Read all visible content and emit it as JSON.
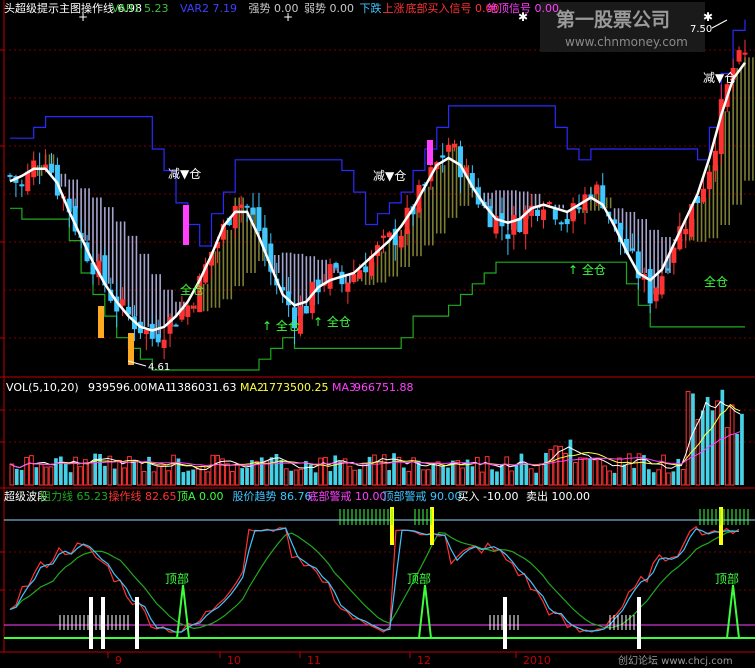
{
  "colors": {
    "bg": "#000000",
    "up": "#ff3232",
    "down": "#3ec6ff",
    "limit": "#ff40ff",
    "ma_white": "#ffffff",
    "resistance": "#2a2aff",
    "support": "#1faa1f",
    "hist_up": "#8b8b3c",
    "hist_dn": "#b6b6e6",
    "yellow": "#ffff00",
    "axis": "#c00000",
    "green_text": "#3cff3c",
    "watermark": "#9a9a9a"
  },
  "main": {
    "indicator_bar": [
      {
        "name": "头超级提示主图操作线",
        "value": "6.98",
        "color": "#ffffff"
      },
      {
        "name": "VAR1",
        "value": "5.23",
        "color": "#3cc03c"
      },
      {
        "name": "VAR2",
        "value": "7.19",
        "color": "#4040ff"
      },
      {
        "name": "强势",
        "value": "0.00",
        "color": "#c8c8c8"
      },
      {
        "name": "弱势",
        "value": "0.00",
        "color": "#c8c8c8"
      },
      {
        "name": "下跌",
        "value": "",
        "color": "#3ec6ff"
      },
      {
        "name": "上涨",
        "value": "",
        "color": "#ff3232"
      },
      {
        "name": "底部买入信号",
        "value": "0.00",
        "color": "#ff3232"
      },
      {
        "name": "绝顶信号",
        "value": "0.00",
        "color": "#ff40ff"
      }
    ],
    "high_label": "7.50",
    "low_label": "4.61",
    "labels": {
      "reduce": "减▼仓",
      "full": "全仓",
      "full_up": "↑ 全仓"
    },
    "watermark_title": "第一股票公司",
    "watermark_url": "www.chnmoney.com"
  },
  "volume": {
    "title": "VOL(5,10,20)",
    "value": "939596.00",
    "ma1_label": "MA1",
    "ma1_value": "1386031.63",
    "ma2_label": "MA2",
    "ma2_value": "1773500.25",
    "ma3_label": "MA3",
    "ma3_value": "966751.88"
  },
  "osc": {
    "items": [
      {
        "name": "超级波段",
        "value": "",
        "color": "#ffffff"
      },
      {
        "name": "阻力线",
        "value": "65.23",
        "color": "#1faa1f"
      },
      {
        "name": "操作线",
        "value": "82.65",
        "color": "#ff3232"
      },
      {
        "name": "顶A",
        "value": "0.00",
        "color": "#3cff3c"
      },
      {
        "name": "股价趋势",
        "value": "86.76",
        "color": "#3ec6ff"
      },
      {
        "name": "底部警戒",
        "value": "10.00",
        "color": "#ff40ff"
      },
      {
        "name": "顶部警戒",
        "value": "90.00",
        "color": "#3ec6ff"
      },
      {
        "name": "买入",
        "value": "-10.00",
        "color": "#ffffff"
      },
      {
        "name": "卖出",
        "value": "100.00",
        "color": "#ffffff"
      }
    ],
    "top_label": "顶部"
  },
  "axis": {
    "months": [
      "9",
      "10",
      "11",
      "12",
      "2010"
    ]
  },
  "footer": {
    "watermark": "创幻论坛 www.chcj.com"
  },
  "chart_data": {
    "type": "candlestick",
    "panels": [
      "price",
      "volume",
      "oscillator"
    ],
    "y_range_price": [
      4.4,
      7.6
    ],
    "price_close_approx": [
      6.2,
      6.1,
      6.3,
      6.4,
      6.1,
      5.9,
      5.6,
      5.4,
      5.2,
      5.0,
      4.9,
      4.8,
      4.7,
      4.8,
      4.9,
      5.0,
      5.2,
      5.5,
      5.7,
      6.0,
      5.9,
      5.7,
      5.3,
      5.1,
      4.9,
      5.0,
      5.2,
      5.3,
      5.2,
      5.3,
      5.4,
      5.5,
      5.6,
      5.7,
      5.9,
      6.1,
      6.3,
      6.5,
      6.3,
      6.1,
      5.9,
      5.8,
      5.7,
      5.8,
      5.9,
      6.0,
      5.9,
      5.8,
      5.9,
      6.1,
      6.0,
      5.7,
      5.5,
      5.3,
      5.1,
      5.3,
      5.6,
      5.8,
      6.0,
      6.3,
      6.8,
      7.2,
      7.3
    ]
  }
}
